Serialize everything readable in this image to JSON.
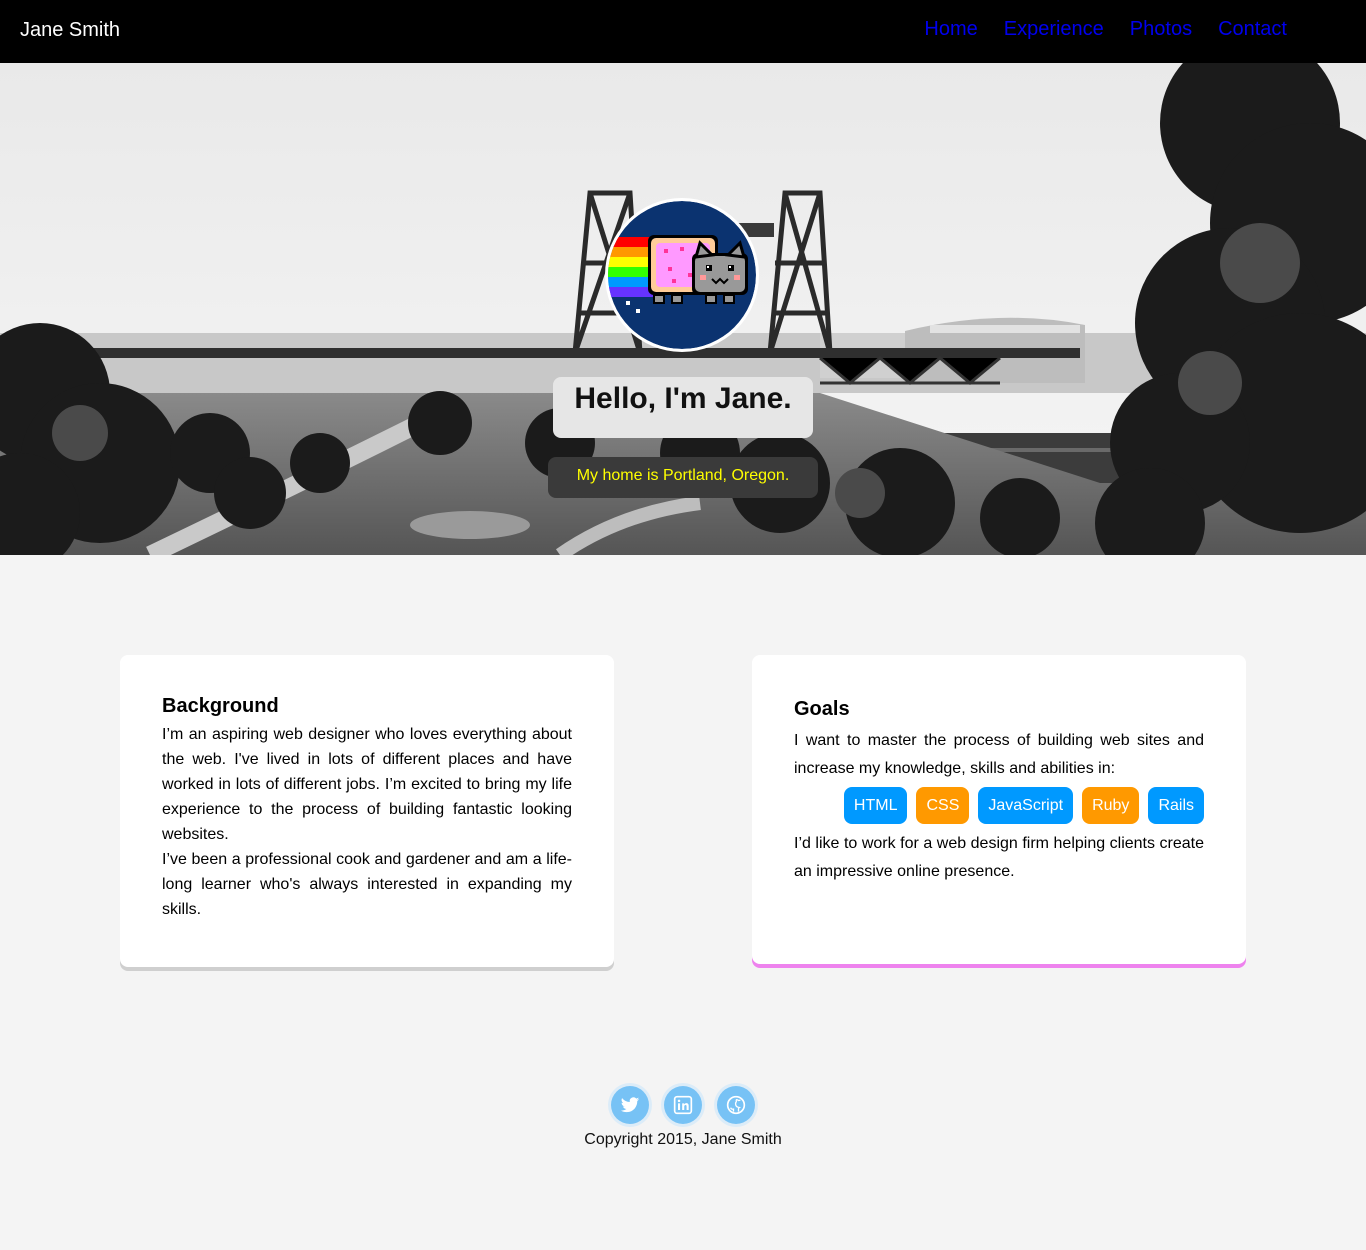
{
  "header": {
    "brand": "Jane Smith",
    "nav": [
      "Home",
      "Experience",
      "Photos",
      "Contact"
    ]
  },
  "hero": {
    "greeting": "Hello, I'm Jane.",
    "location": "My home is Portland, Oregon.",
    "avatar_icon": "nyan-cat-icon"
  },
  "background": {
    "title": "Background",
    "paragraphs": [
      "I’m an aspiring web designer who loves everything about the web. I've lived in lots of different places and have worked in lots of different jobs. I’m excited to bring my life experience to the process of building fantastic looking websites.",
      "I’ve been a professional cook and gardener and am a life-long learner who's always interested in expanding my skills."
    ]
  },
  "goals": {
    "title": "Goals",
    "intro": "I want to master the process of building web sites and increase my knowledge, skills and abilities in:",
    "skills": [
      {
        "label": "HTML",
        "color": "#0099ff"
      },
      {
        "label": "CSS",
        "color": "#ff9900"
      },
      {
        "label": "JavaScript",
        "color": "#0099ff"
      },
      {
        "label": "Ruby",
        "color": "#ff9900"
      },
      {
        "label": "Rails",
        "color": "#0099ff"
      }
    ],
    "outro": "I’d like to work for a web design firm helping clients create an impressive online presence."
  },
  "footer": {
    "social_icons": [
      "twitter-icon",
      "linkedin-icon",
      "github-icon"
    ],
    "copyright": "Copyright 2015, Jane Smith"
  },
  "colors": {
    "nav_link": "#0000ee",
    "location_text": "#ffff00",
    "goals_accent": "#ee82ee",
    "skill_blue": "#0099ff",
    "skill_orange": "#ff9900",
    "social": "#77c2f5"
  }
}
